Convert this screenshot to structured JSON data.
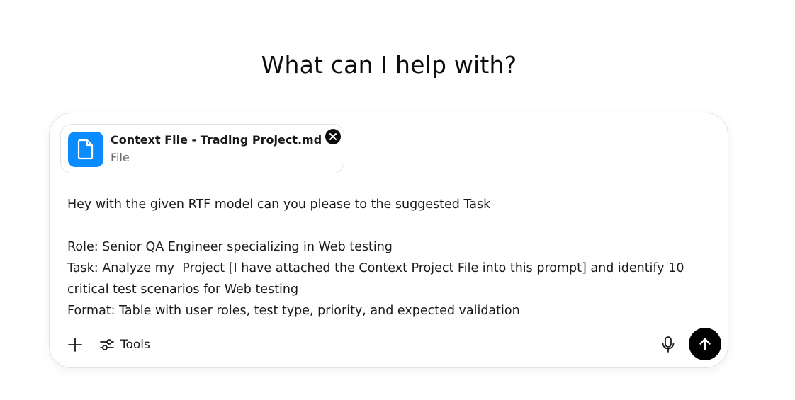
{
  "header": {
    "title": "What can I help with?"
  },
  "attachment": {
    "file_name": "Context File - Trading Project.md",
    "file_type": "File",
    "icon": "file-document-icon",
    "remove_icon": "close-circle-icon",
    "accent_color": "#0a8cff"
  },
  "composer": {
    "lines": [
      "Hey with the given RTF model can you please to the suggested Task",
      "",
      "Role: Senior QA Engineer specializing in Web testing",
      "Task: Analyze my  Project [I have attached the Context Project File into this prompt] and identify 10",
      "critical test scenarios for Web testing",
      "Format: Table with user roles, test type, priority, and expected validation"
    ]
  },
  "toolbar": {
    "plus_icon": "plus-icon",
    "tools_icon": "sliders-icon",
    "tools_label": "Tools",
    "mic_icon": "microphone-icon",
    "send_icon": "arrow-up-icon",
    "send_color": "#000000"
  }
}
